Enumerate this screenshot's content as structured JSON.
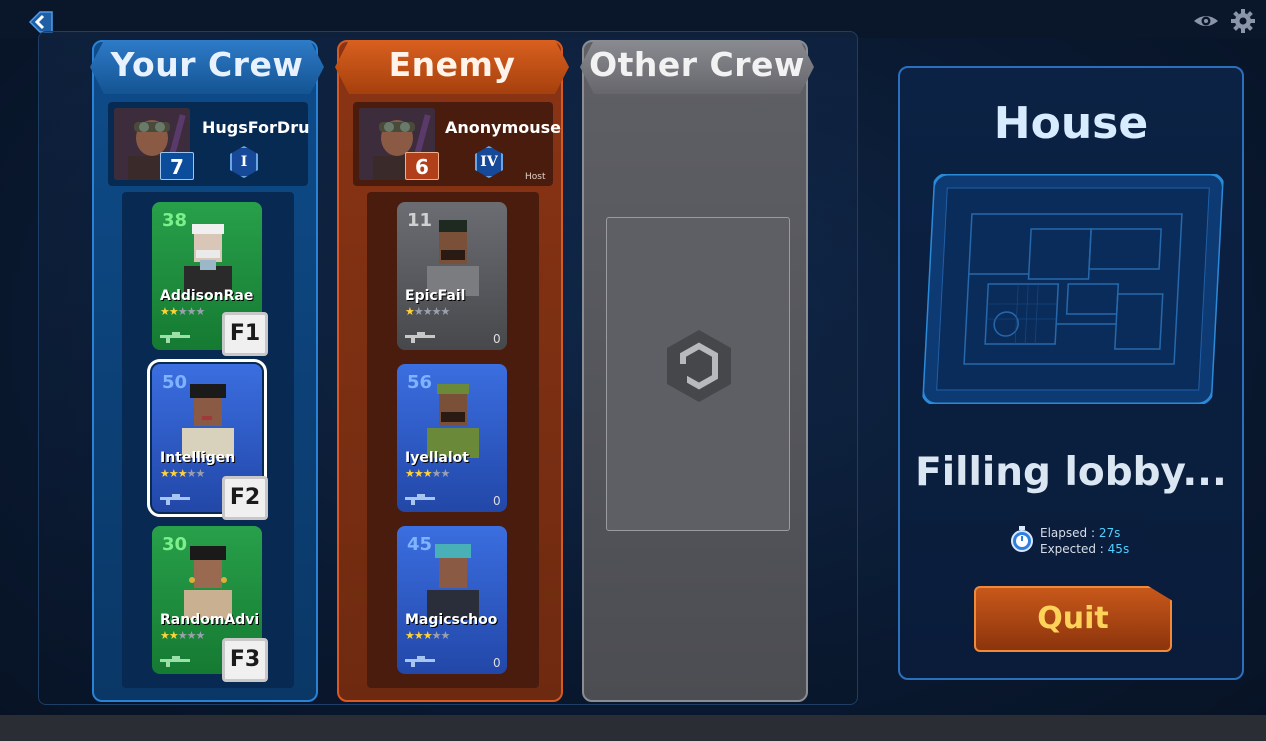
{
  "header": {
    "back_icon": "chevron-left-icon",
    "eye_icon": "eye-icon",
    "settings_icon": "gear-icon"
  },
  "your_crew": {
    "title": "Your Crew",
    "player": {
      "name": "HugsForDru",
      "level": "7",
      "rank": "I"
    },
    "characters": [
      {
        "level": "38",
        "name": "AddisonRae",
        "stars": 2,
        "hotkey": "F1",
        "color": "green",
        "weapon": "rifle-icon"
      },
      {
        "level": "50",
        "name": "Intelligen",
        "stars": 3,
        "hotkey": "F2",
        "color": "blue",
        "weapon": "rifle-icon",
        "selected": true
      },
      {
        "level": "30",
        "name": "RandomAdvi",
        "stars": 2,
        "hotkey": "F3",
        "color": "green",
        "weapon": "rifle-icon"
      }
    ]
  },
  "enemy_crew": {
    "title": "Enemy Crew",
    "player": {
      "name": "Anonymouse",
      "level": "6",
      "rank": "IV",
      "tag": "Host"
    },
    "characters": [
      {
        "level": "11",
        "name": "EpicFail",
        "stars": 1,
        "count": "0",
        "color": "gray",
        "weapon": "rifle-icon"
      },
      {
        "level": "56",
        "name": "Iyellalot",
        "stars": 3,
        "count": "0",
        "color": "blue",
        "weapon": "rifle-icon"
      },
      {
        "level": "45",
        "name": "Magicschoo",
        "stars": 3,
        "count": "0",
        "color": "blue",
        "weapon": "rifle-icon"
      }
    ]
  },
  "other_crew": {
    "title": "Other Crew",
    "loading_icon": "hexagon-loading-icon"
  },
  "map": {
    "name": "House",
    "status": "Filling lobby...",
    "elapsed_label": "Elapsed : ",
    "elapsed_value": "27s",
    "expected_label": "Expected : ",
    "expected_value": "45s",
    "quit_label": "Quit"
  },
  "colors": {
    "your_crew": "#0e4c8a",
    "enemy_crew": "#8a3414",
    "other_crew": "#5f6066",
    "accent": "#4fd0ff",
    "quit_text": "#ffd25a"
  }
}
